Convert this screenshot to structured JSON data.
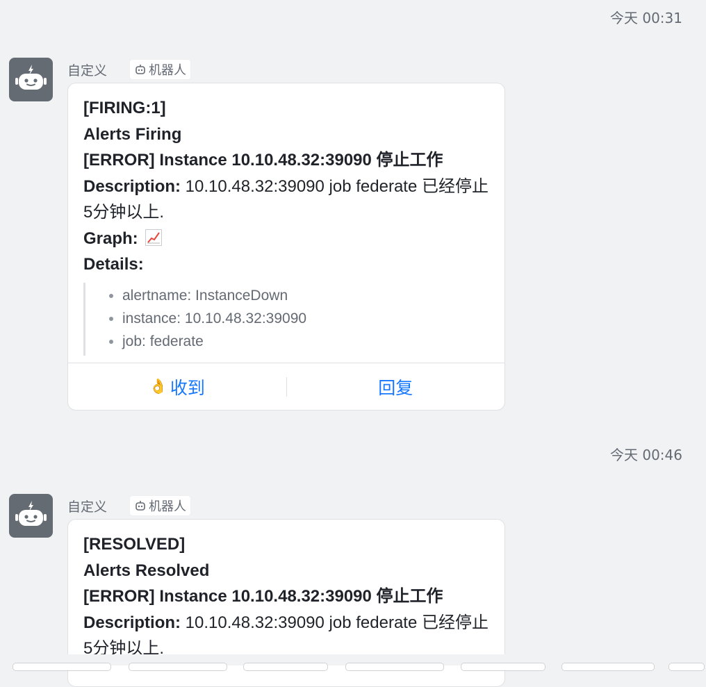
{
  "messages": [
    {
      "time": "今天 00:31",
      "sender": "自定义",
      "bot_tag": "机器人",
      "status_line": "[FIRING:1]",
      "title": "Alerts Firing",
      "error_line": "[ERROR] Instance 10.10.48.32:39090 停止工作",
      "description_label": "Description:",
      "description_text": " 10.10.48.32:39090 job federate 已经停止5分钟以上.",
      "graph_label": "Graph:",
      "details_label": "Details:",
      "details": [
        "alertname: InstanceDown",
        "instance: 10.10.48.32:39090",
        "job: federate"
      ],
      "actions": {
        "acknowledge": "收到",
        "reply": "回复"
      }
    },
    {
      "time": "今天 00:46",
      "sender": "自定义",
      "bot_tag": "机器人",
      "status_line": "[RESOLVED]",
      "title": "Alerts Resolved",
      "error_line": "[ERROR] Instance 10.10.48.32:39090 停止工作",
      "description_label": "Description:",
      "description_text": " 10.10.48.32:39090 job federate 已经停止5分钟以上."
    }
  ],
  "colors": {
    "background": "#f1f2f3",
    "avatar": "#646b73",
    "link": "#1677ff",
    "graph_line": "#e8453c"
  },
  "icons": {
    "avatar": "robot-avatar-icon",
    "bot_tag": "robot-icon",
    "graph": "chart-increasing-icon",
    "acknowledge": "ok-hand-icon"
  }
}
